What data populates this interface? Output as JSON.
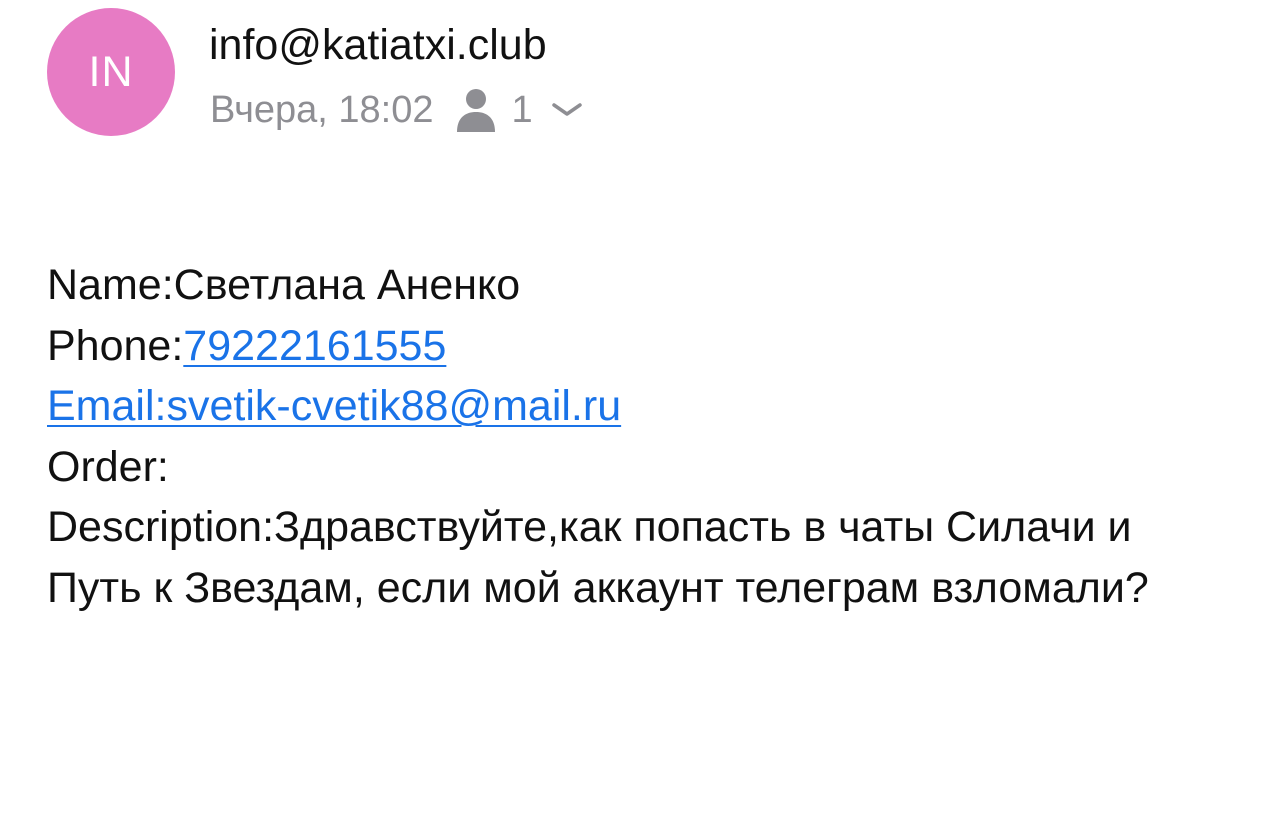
{
  "sender": {
    "avatar_initials": "IN",
    "avatar_color": "#e77bc4",
    "address": "info@katiatxi.club"
  },
  "meta": {
    "date_time": "Вчера, 18:02",
    "recipient_icon": "person-icon",
    "recipients_count": "1",
    "expand_icon": "chevron-down-icon"
  },
  "message": {
    "name_label": "Name:",
    "name_value": "Светлана Аненко",
    "phone_label": "Phone:",
    "phone_value": "79222161555",
    "email_link": "Email:svetik-cvetik88@mail.ru",
    "order_label": "Order:",
    "description_label": "Description:",
    "description_value": "Здравствуйте,как попасть в чаты Силачи и Путь к Звездам, если мой аккаунт телеграм взломали?"
  },
  "colors": {
    "link": "#1a73e8",
    "meta_text": "#8e8e93"
  }
}
